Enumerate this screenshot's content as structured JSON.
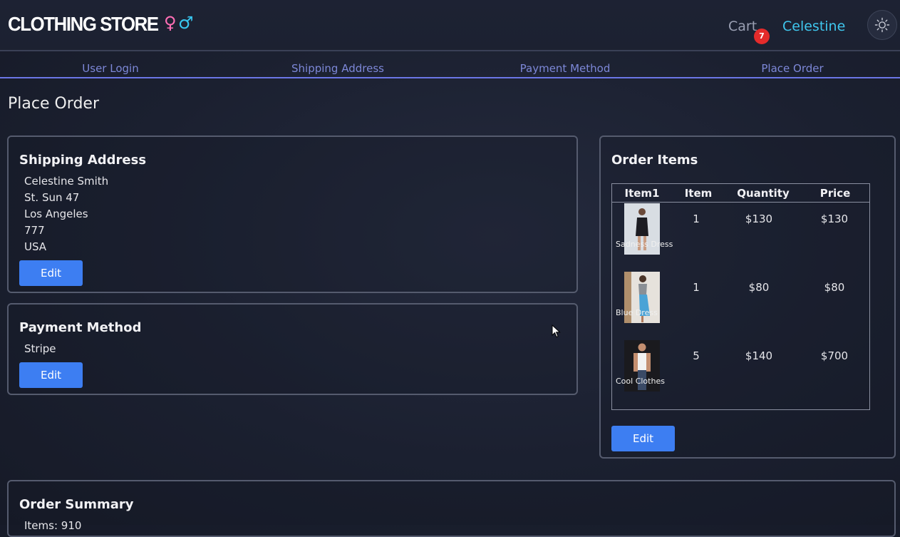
{
  "header": {
    "logo_text": "CLOTHING STORE",
    "female_symbol": "♀",
    "male_symbol": "♂",
    "cart_label": "Cart",
    "cart_count": "7",
    "user_name": "Celestine",
    "theme_icon": "sun-icon"
  },
  "steps": [
    "User Login",
    "Shipping Address",
    "Payment Method",
    "Place Order"
  ],
  "page_title": "Place Order",
  "shipping": {
    "title": "Shipping Address",
    "lines": [
      "Celestine Smith",
      "St. Sun 47",
      "Los Angeles",
      "777",
      "USA"
    ],
    "edit_label": "Edit"
  },
  "payment": {
    "title": "Payment Method",
    "method": "Stripe",
    "edit_label": "Edit"
  },
  "order_items": {
    "title": "Order Items",
    "columns": [
      "Item1",
      "Item",
      "Quantity",
      "Price"
    ],
    "rows": [
      {
        "name": "Sadness Dress",
        "qty": "1",
        "unit_price": "$130",
        "price": "$130"
      },
      {
        "name": "Blue Dress",
        "qty": "1",
        "unit_price": "$80",
        "price": "$80"
      },
      {
        "name": "Cool Clothes",
        "qty": "5",
        "unit_price": "$140",
        "price": "$700"
      }
    ],
    "edit_label": "Edit"
  },
  "summary": {
    "title": "Order Summary",
    "items_line": "Items: 910"
  },
  "colors": {
    "accent": "#3d7ef2",
    "step_active": "#6b76e6",
    "user": "#3fc7ee",
    "badge": "#e42b2b"
  }
}
